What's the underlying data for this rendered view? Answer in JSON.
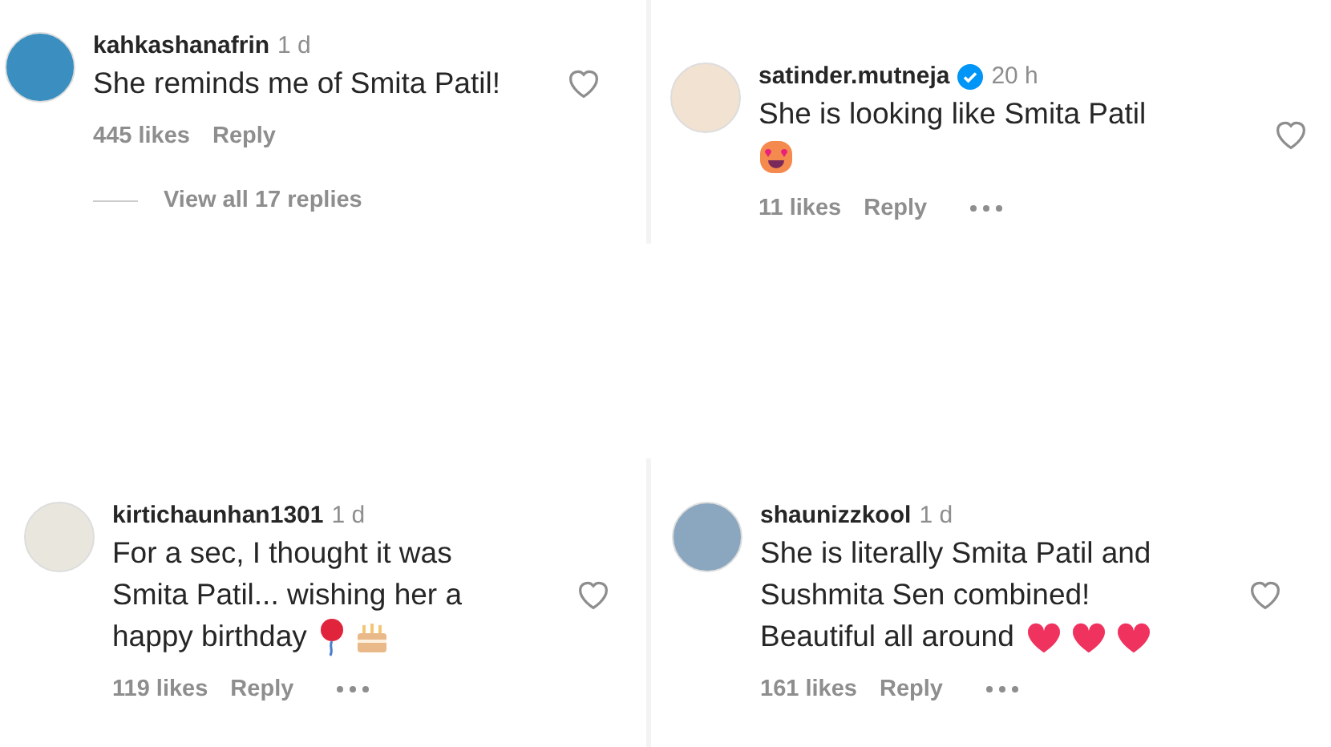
{
  "comments": [
    {
      "username": "kahkashanafrin",
      "verified": false,
      "time": "1 d",
      "lines": [
        "She reminds me of Smita Patil!"
      ],
      "likes": "445 likes",
      "reply": "Reply",
      "more_menu": false,
      "view_replies": "View all 17 replies"
    },
    {
      "username": "satinder.mutneja",
      "verified": true,
      "time": "20 h",
      "lines": [
        "She is looking like Smita Patil"
      ],
      "emojis": [
        {
          "kind": "heart-eyes"
        }
      ],
      "likes": "11 likes",
      "reply": "Reply",
      "more_menu": true
    },
    {
      "username": "kirtichaunhan1301",
      "verified": false,
      "time": "1 d",
      "lines": [
        "For a sec, I thought it was",
        "Smita Patil... wishing her a",
        "happy birthday"
      ],
      "emojis": [
        {
          "kind": "balloon"
        },
        {
          "kind": "cake"
        }
      ],
      "likes": "119 likes",
      "reply": "Reply",
      "more_menu": true
    },
    {
      "username": "shaunizzkool",
      "verified": false,
      "time": "1 d",
      "lines": [
        "She is literally Smita Patil and",
        "Sushmita Sen combined!",
        "Beautiful all around"
      ],
      "emojis": [
        {
          "kind": "heart"
        },
        {
          "kind": "heart"
        },
        {
          "kind": "heart"
        }
      ],
      "likes": "161 likes",
      "reply": "Reply",
      "more_menu": true
    }
  ]
}
